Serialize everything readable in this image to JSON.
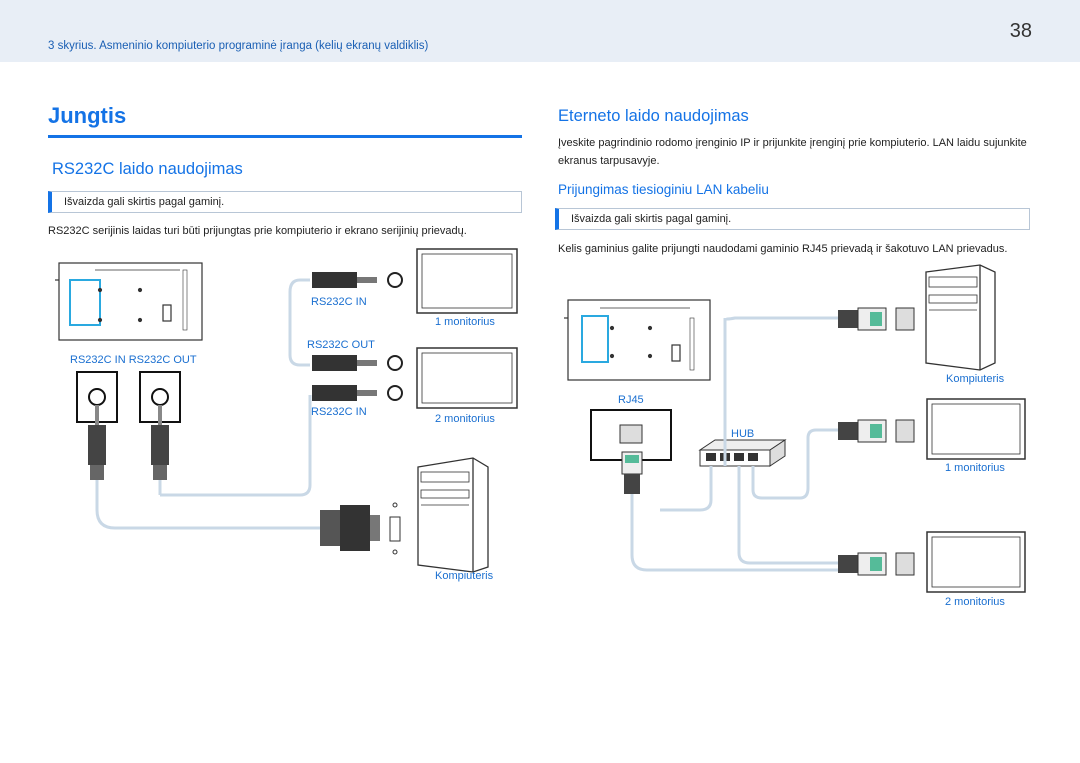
{
  "header": {
    "chapter": "3 skyrius. Asmeninio kompiuterio programinė įranga (kelių ekranų valdiklis)",
    "page_number": "38"
  },
  "left": {
    "title": "Jungtis",
    "section": "RS232C laido naudojimas",
    "note": "Išvaizda gali skirtis pagal gaminį.",
    "paragraph": "RS232C serijinis laidas turi būti prijungtas prie kompiuterio ir ekrano serijinių prievadų.",
    "labels": {
      "rs232c_in_out_left": "RS232C IN  RS232C OUT",
      "rs232c_in_1": "RS232C IN",
      "rs232c_out": "RS232C OUT",
      "rs232c_in_2": "RS232C IN",
      "monitor_1": "1 monitorius",
      "monitor_2": "2 monitorius",
      "computer": "Kompiuteris"
    }
  },
  "right": {
    "section": "Eterneto laido naudojimas",
    "paragraph1": "Įveskite pagrindinio rodomo įrenginio IP ir prijunkite įrenginį prie kompiuterio. LAN laidu sujunkite ekranus tarpusavyje.",
    "subsection": "Prijungimas tiesioginiu LAN kabeliu",
    "note": "Išvaizda gali skirtis pagal gaminį.",
    "paragraph2": "Kelis gaminius galite prijungti naudodami gaminio RJ45 prievadą ir šakotuvo LAN prievadus.",
    "labels": {
      "computer": "Kompiuteris",
      "rj45": "RJ45",
      "hub": "HUB",
      "monitor_1": "1 monitorius",
      "monitor_2": "2 monitorius"
    }
  },
  "colors": {
    "accent": "#1473e6",
    "cable": "#c9d8e6",
    "highlight": "#2aa9e0"
  }
}
